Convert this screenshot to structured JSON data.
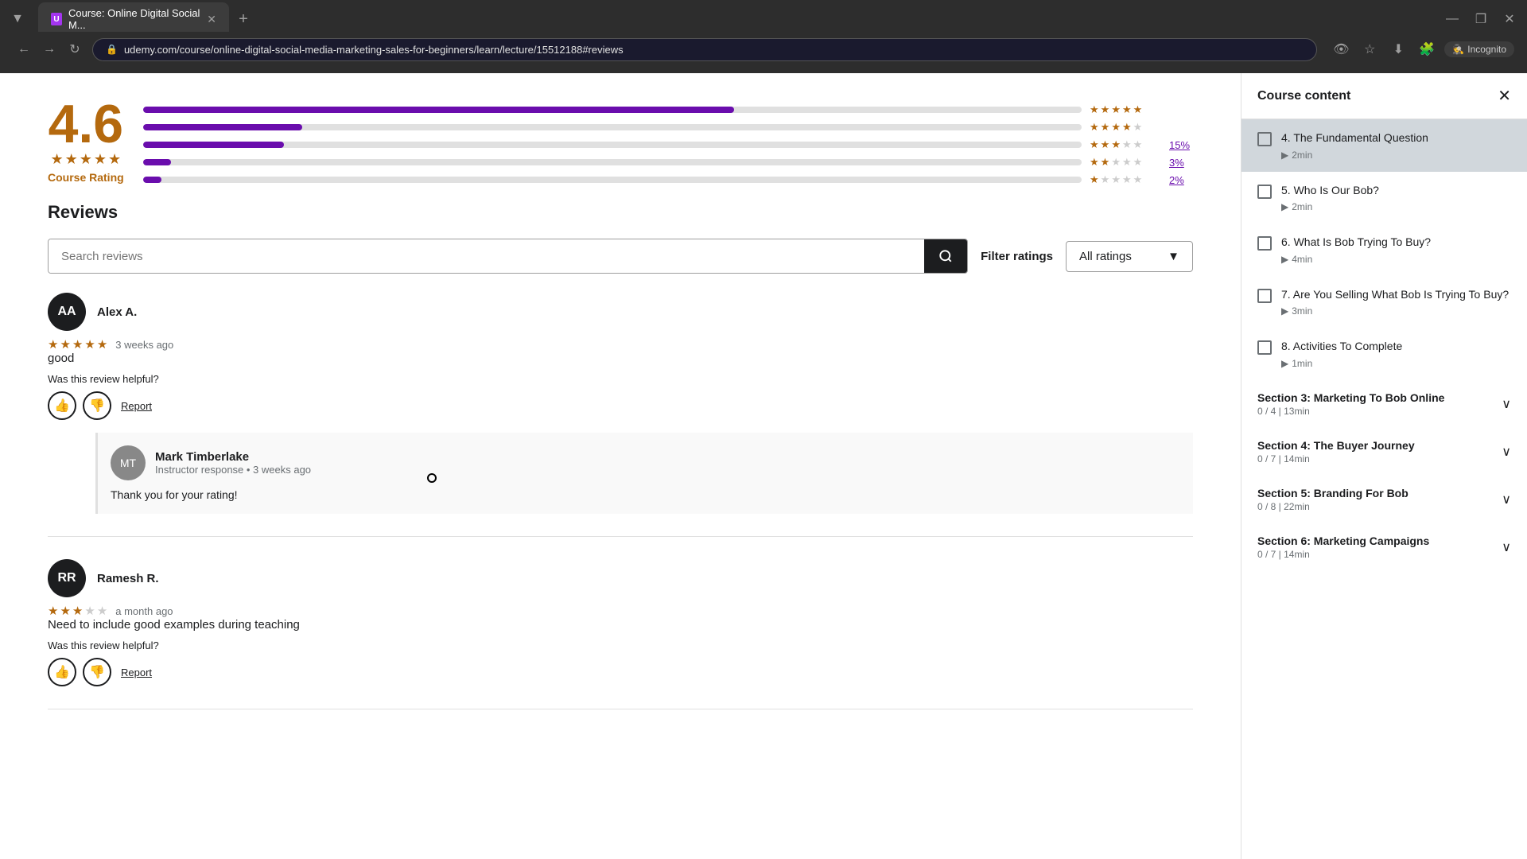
{
  "browser": {
    "tab_title": "Course: Online Digital Social M...",
    "url": "udemy.com/course/online-digital-social-media-marketing-sales-for-beginners/learn/lecture/15512188#reviews",
    "new_tab_label": "+",
    "incognito_label": "Incognito",
    "window_minimize": "—",
    "window_maximize": "❐",
    "window_close": "✕"
  },
  "rating": {
    "number": "4.6",
    "label": "Course Rating",
    "bars": [
      {
        "stars": 5,
        "fill": 63,
        "pct": ""
      },
      {
        "stars": 4,
        "fill": 17,
        "pct": ""
      },
      {
        "stars": 3,
        "fill": 15,
        "pct": "15%"
      },
      {
        "stars": 2,
        "fill": 3,
        "pct": "3%"
      },
      {
        "stars": 1,
        "fill": 2,
        "pct": "2%"
      }
    ]
  },
  "reviews": {
    "title": "Reviews",
    "search_placeholder": "Search reviews",
    "filter_label": "Filter ratings",
    "filter_value": "All ratings",
    "items": [
      {
        "initials": "AA",
        "name": "Alex A.",
        "stars": 4.5,
        "time": "3 weeks ago",
        "text": "good",
        "helpful_text": "Was this review helpful?",
        "report_label": "Report",
        "instructor_response": {
          "name": "Mark Timberlake",
          "label": "Instructor response • 3 weeks ago",
          "text": "Thank you for your rating!"
        }
      },
      {
        "initials": "RR",
        "name": "Ramesh R.",
        "stars": 3,
        "time": "a month ago",
        "text": "Need to include good examples during teaching",
        "helpful_text": "Was this review helpful?",
        "report_label": "Report"
      }
    ]
  },
  "sidebar": {
    "title": "Course content",
    "close_label": "✕",
    "items": [
      {
        "id": "item-4",
        "title": "4. The Fundamental Question",
        "meta": "2min",
        "active": true
      },
      {
        "id": "item-5",
        "title": "5. Who Is Our Bob?",
        "meta": "2min",
        "active": false
      },
      {
        "id": "item-6",
        "title": "6. What Is Bob Trying To Buy?",
        "meta": "4min",
        "active": false
      },
      {
        "id": "item-7",
        "title": "7. Are You Selling What Bob Is Trying To Buy?",
        "meta": "3min",
        "active": false
      },
      {
        "id": "item-8",
        "title": "8. Activities To Complete",
        "meta": "1min",
        "active": false
      }
    ],
    "sections": [
      {
        "title": "Section 3: Marketing To Bob Online",
        "meta": "0 / 4 | 13min"
      },
      {
        "title": "Section 4: The Buyer Journey",
        "meta": "0 / 7 | 14min"
      },
      {
        "title": "Section 5: Branding For Bob",
        "meta": "0 / 8 | 22min"
      },
      {
        "title": "Section 6: Marketing Campaigns",
        "meta": "0 / 7 | 14min"
      }
    ]
  }
}
